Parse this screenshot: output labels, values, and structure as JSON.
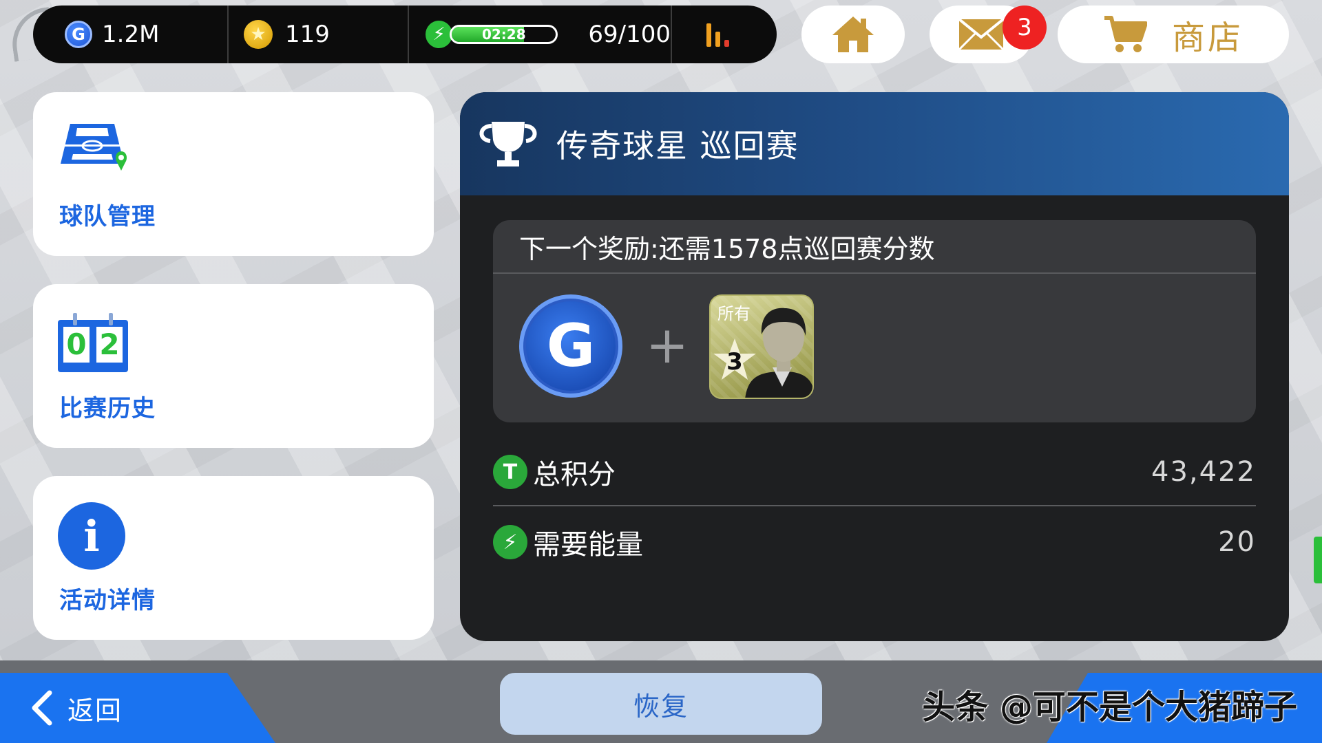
{
  "statusbar": {
    "gp_icon": "G",
    "gp": "1.2M",
    "coins": "119",
    "energy_timer": "02:28",
    "energy_fill": 0.69,
    "energy": "69/100"
  },
  "top_buttons": {
    "mail_badge": "3",
    "shop_label": "商店"
  },
  "menu": [
    {
      "label": "球队管理",
      "icon": "pitch-location-icon"
    },
    {
      "label": "比赛历史",
      "icon": "scoreboard-icon",
      "score_left": "0",
      "score_right": "2"
    },
    {
      "label": "活动详情",
      "icon": "info-icon",
      "icon_glyph": "i"
    }
  ],
  "event": {
    "title": "传奇球星 巡回赛",
    "next_reward": "下一个奖励:还需1578点巡回赛分数",
    "reward_coin": "G",
    "reward_plus": "+",
    "card_label": "所有",
    "card_stars": "3",
    "stats": [
      {
        "icon": "T",
        "label": "总积分",
        "value": "43,422"
      },
      {
        "icon": "⚡",
        "label": "需要能量",
        "value": "20"
      }
    ]
  },
  "bottom": {
    "back_label": "返回",
    "restore_label": "恢复",
    "watermark": "头条 @可不是个大猪蹄子"
  },
  "colors": {
    "accent_blue": "#1a73f0",
    "energy_green": "#2bbf3a",
    "badge_red": "#ee2222",
    "gold": "#c89a3c"
  }
}
